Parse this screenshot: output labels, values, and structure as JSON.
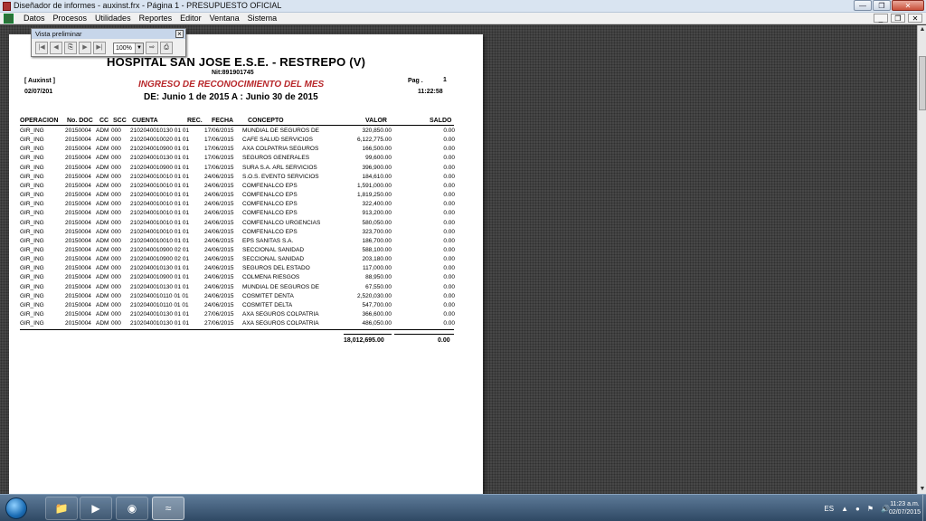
{
  "window": {
    "title": "Diseñador de informes - auxinst.frx - Página 1 - PRESUPUESTO OFICIAL"
  },
  "menu": {
    "items": [
      "Datos",
      "Procesos",
      "Utilidades",
      "Reportes",
      "Editor",
      "Ventana",
      "Sistema"
    ]
  },
  "preview_toolbar": {
    "title": "Vista preliminar",
    "zoom": "100%"
  },
  "report": {
    "hospital": "HOSPITAL SAN JOSE E.S.E. - RESTREPO (V)",
    "nit": "Nit:891901745",
    "user": "[ Auxinst ]",
    "date": "02/07/201",
    "title": "INGRESO DE RECONOCIMIENTO DEL MES",
    "subtitle": "DE: Junio  1 de 2015  A : Junio 30 de 2015",
    "page_label": "Pag .",
    "page_number": "1",
    "time": "11:22:58",
    "headers": {
      "operacion": "OPERACION",
      "doc": "No. DOC",
      "cc": "CC",
      "scc": "SCC",
      "cuenta": "CUENTA",
      "rec": "REC.",
      "fecha": "FECHA",
      "concepto": "CONCEPTO",
      "valor": "VALOR",
      "saldo": "SALDO"
    },
    "rows": [
      [
        "GIR_ING",
        "20150004",
        "ADM",
        "000",
        "2102040010130 01 01",
        "17/06/2015",
        "MUNDIAL DE SEGUROS DE",
        "320,850.00",
        "0.00"
      ],
      [
        "GIR_ING",
        "20150004",
        "ADM",
        "000",
        "2102040010020 01 01",
        "17/06/2015",
        "CAFE SALUD SERVICIOS",
        "6,122,775.00",
        "0.00"
      ],
      [
        "GIR_ING",
        "20150004",
        "ADM",
        "000",
        "2102040010900 01 01",
        "17/06/2015",
        "AXA COLPATRIA SEGUROS",
        "166,500.00",
        "0.00"
      ],
      [
        "GIR_ING",
        "20150004",
        "ADM",
        "000",
        "2102040010130 01 01",
        "17/06/2015",
        "SEGUROS GENERALES",
        "99,600.00",
        "0.00"
      ],
      [
        "GIR_ING",
        "20150004",
        "ADM",
        "000",
        "2102040010900 01 01",
        "17/06/2015",
        "SURA S.A. ARL SERVICIOS",
        "396,900.00",
        "0.00"
      ],
      [
        "GIR_ING",
        "20150004",
        "ADM",
        "000",
        "2102040010010 01 01",
        "24/06/2015",
        "S.O.S. EVENTO SERVICIOS",
        "184,610.00",
        "0.00"
      ],
      [
        "GIR_ING",
        "20150004",
        "ADM",
        "000",
        "2102040010010 01 01",
        "24/06/2015",
        "COMFENALCO EPS",
        "1,591,000.00",
        "0.00"
      ],
      [
        "GIR_ING",
        "20150004",
        "ADM",
        "000",
        "2102040010010 01 01",
        "24/06/2015",
        "COMFENALCO EPS",
        "1,819,250.00",
        "0.00"
      ],
      [
        "GIR_ING",
        "20150004",
        "ADM",
        "000",
        "2102040010010 01 01",
        "24/06/2015",
        "COMFENALCO EPS",
        "322,400.00",
        "0.00"
      ],
      [
        "GIR_ING",
        "20150004",
        "ADM",
        "000",
        "2102040010010 01 01",
        "24/06/2015",
        "COMFENALCO EPS",
        "913,200.00",
        "0.00"
      ],
      [
        "GIR_ING",
        "20150004",
        "ADM",
        "000",
        "2102040010010 01 01",
        "24/06/2015",
        "COMFENALCO URGENCIAS",
        "580,050.00",
        "0.00"
      ],
      [
        "GIR_ING",
        "20150004",
        "ADM",
        "000",
        "2102040010010 01 01",
        "24/06/2015",
        "COMFENALCO EPS",
        "323,700.00",
        "0.00"
      ],
      [
        "GIR_ING",
        "20150004",
        "ADM",
        "000",
        "2102040010010 01 01",
        "24/06/2015",
        "EPS SANITAS S.A.",
        "186,700.00",
        "0.00"
      ],
      [
        "GIR_ING",
        "20150004",
        "ADM",
        "000",
        "2102040010900 02 01",
        "24/06/2015",
        "SECCIONAL SANIDAD",
        "588,100.00",
        "0.00"
      ],
      [
        "GIR_ING",
        "20150004",
        "ADM",
        "000",
        "2102040010900 02 01",
        "24/06/2015",
        "SECCIONAL SANIDAD",
        "203,180.00",
        "0.00"
      ],
      [
        "GIR_ING",
        "20150004",
        "ADM",
        "000",
        "2102040010130 01 01",
        "24/06/2015",
        "SEGUROS DEL ESTADO",
        "117,000.00",
        "0.00"
      ],
      [
        "GIR_ING",
        "20150004",
        "ADM",
        "000",
        "2102040010900 01 01",
        "24/06/2015",
        "COLMENA RIESGOS",
        "88,950.00",
        "0.00"
      ],
      [
        "GIR_ING",
        "20150004",
        "ADM",
        "000",
        "2102040010130 01 01",
        "24/06/2015",
        "MUNDIAL DE SEGUROS DE",
        "67,550.00",
        "0.00"
      ],
      [
        "GIR_ING",
        "20150004",
        "ADM",
        "000",
        "2102040010110 01 01",
        "24/06/2015",
        "COSMITET DENTA",
        "2,520,030.00",
        "0.00"
      ],
      [
        "GIR_ING",
        "20150004",
        "ADM",
        "000",
        "2102040010110 01 01",
        "24/06/2015",
        "COSMITET DELTA",
        "547,700.00",
        "0.00"
      ],
      [
        "GIR_ING",
        "20150004",
        "ADM",
        "000",
        "2102040010130 01 01",
        "27/06/2015",
        "AXA SEGUROS COLPATRIA",
        "366,600.00",
        "0.00"
      ],
      [
        "GIR_ING",
        "20150004",
        "ADM",
        "000",
        "2102040010130 01 01",
        "27/06/2015",
        "AXA SEGUROS COLPATRIA",
        "486,050.00",
        "0.00"
      ]
    ],
    "total_valor": "18,012,695.00",
    "total_saldo": "0.00"
  },
  "taskbar": {
    "lang": "ES",
    "time": "11:23 a.m.",
    "date": "02/07/2015"
  }
}
